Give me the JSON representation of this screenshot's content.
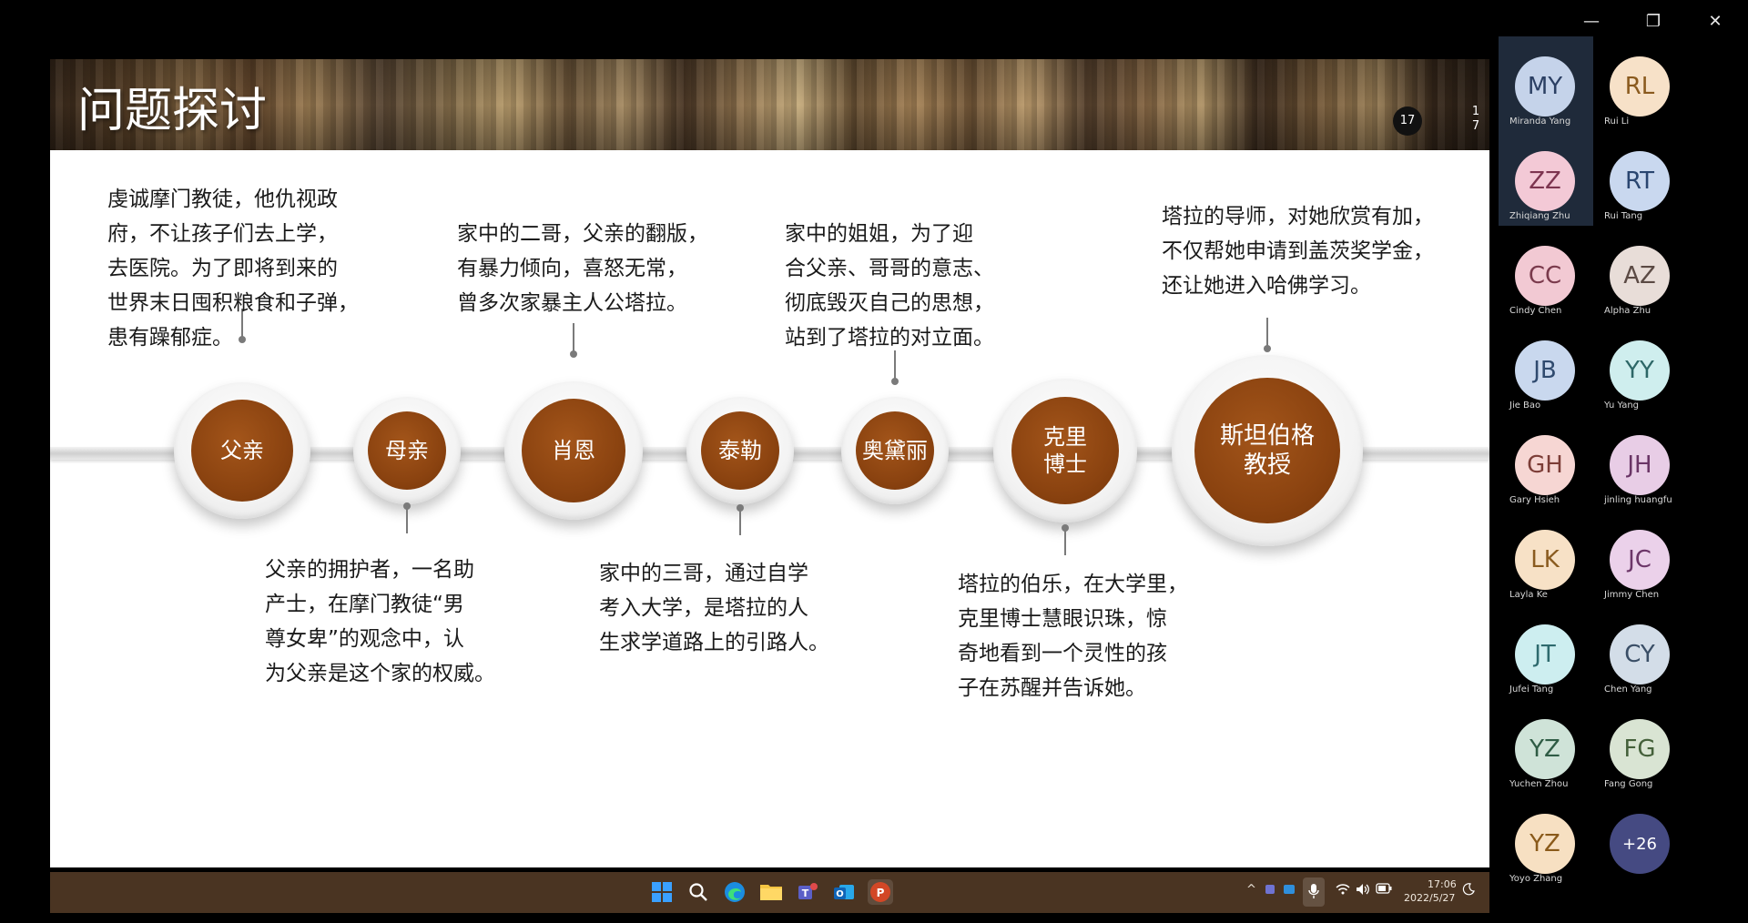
{
  "window_controls": {
    "minimize": "—",
    "restore": "❐",
    "close": "✕"
  },
  "slide": {
    "title": "问题探讨",
    "page_badge": "17",
    "page_side": [
      "1",
      "7"
    ]
  },
  "characters": [
    {
      "name": "父亲",
      "desc": [
        "虔诚摩门教徒，他仇视政",
        "府，不让孩子们去上学，",
        "去医院。为了即将到来的",
        "世界末日囤积粮食和子弹，",
        "患有躁郁症。"
      ]
    },
    {
      "name": "母亲",
      "desc": [
        "父亲的拥护者，一名助",
        "产士，在摩门教徒“男",
        "尊女卑”的观念中，认",
        "为父亲是这个家的权威。"
      ]
    },
    {
      "name": "肖恩",
      "desc": [
        "家中的二哥，父亲的翻版，",
        "有暴力倾向，喜怒无常，",
        "曾多次家暴主人公塔拉。"
      ]
    },
    {
      "name": "泰勒",
      "desc": [
        "家中的三哥，通过自学",
        "考入大学，是塔拉的人",
        "生求学道路上的引路人。"
      ]
    },
    {
      "name": "奥黛丽",
      "desc": [
        "家中的姐姐，为了迎",
        "合父亲、哥哥的意志、",
        "彻底毁灭自己的思想，",
        "站到了塔拉的对立面。"
      ]
    },
    {
      "name": "克里\n博士",
      "desc": [
        "塔拉的伯乐，在大学里，",
        "克里博士慧眼识珠，惊",
        "奇地看到一个灵性的孩",
        "子在苏醒并告诉她。"
      ]
    },
    {
      "name": "斯坦伯格\n教授",
      "desc": [
        "塔拉的导师，对她欣赏有加，",
        "不仅帮她申请到盖茨奖学金，",
        "还让她进入哈佛学习。"
      ]
    }
  ],
  "taskbar": {
    "icons": [
      "windows-start",
      "search",
      "edge",
      "file-explorer",
      "teams",
      "outlook",
      "powerpoint"
    ],
    "tray_expand": "^",
    "time": "17:06",
    "date": "2022/5/27"
  },
  "participants": [
    {
      "initials": "MY",
      "name": "Miranda Yang",
      "bg": "#c5d3ea",
      "fg": "#2b3f63"
    },
    {
      "initials": "RL",
      "name": "Rui Li",
      "bg": "#f7e1c8",
      "fg": "#8a5a1e"
    },
    {
      "initials": "ZZ",
      "name": "Zhiqiang Zhu",
      "bg": "#f3c9d6",
      "fg": "#7d3550"
    },
    {
      "initials": "RT",
      "name": "Rui Tang",
      "bg": "#c9d8ef",
      "fg": "#2a4670"
    },
    {
      "initials": "CC",
      "name": "Cindy Chen",
      "bg": "#f2c9d3",
      "fg": "#7a3a4c"
    },
    {
      "initials": "AZ",
      "name": "Alpha Zhu",
      "bg": "#e8ddd8",
      "fg": "#5b4a44"
    },
    {
      "initials": "JB",
      "name": "Jie Bao",
      "bg": "#c9d8ee",
      "fg": "#2f4a6e"
    },
    {
      "initials": "YY",
      "name": "Yu Yang",
      "bg": "#cfeeee",
      "fg": "#2d6767"
    },
    {
      "initials": "GH",
      "name": "Gary Hsieh",
      "bg": "#f6d6d3",
      "fg": "#7c3d37"
    },
    {
      "initials": "JH",
      "name": "jinling huangfu",
      "bg": "#e8cde6",
      "fg": "#6a3566"
    },
    {
      "initials": "LK",
      "name": "Layla Ke",
      "bg": "#f7e1c6",
      "fg": "#8a5b1f"
    },
    {
      "initials": "JC",
      "name": "Jimmy Chen",
      "bg": "#ebd1ea",
      "fg": "#6c3668"
    },
    {
      "initials": "JT",
      "name": "Jufei Tang",
      "bg": "#cdeef0",
      "fg": "#2e6a6e"
    },
    {
      "initials": "CY",
      "name": "Chen Yang",
      "bg": "#d3dde8",
      "fg": "#3a4e66"
    },
    {
      "initials": "YZ",
      "name": "Yuchen Zhou",
      "bg": "#cfe3d8",
      "fg": "#2f5c45"
    },
    {
      "initials": "FG",
      "name": "Fang Gong",
      "bg": "#d9e4d3",
      "fg": "#44603a"
    },
    {
      "initials": "YZ",
      "name": "Yoyo Zhang",
      "bg": "#f7e0c2",
      "fg": "#8a5a1a"
    },
    {
      "initials": "+26",
      "name": "",
      "bg": "#454a82",
      "fg": "#ffffff"
    }
  ]
}
